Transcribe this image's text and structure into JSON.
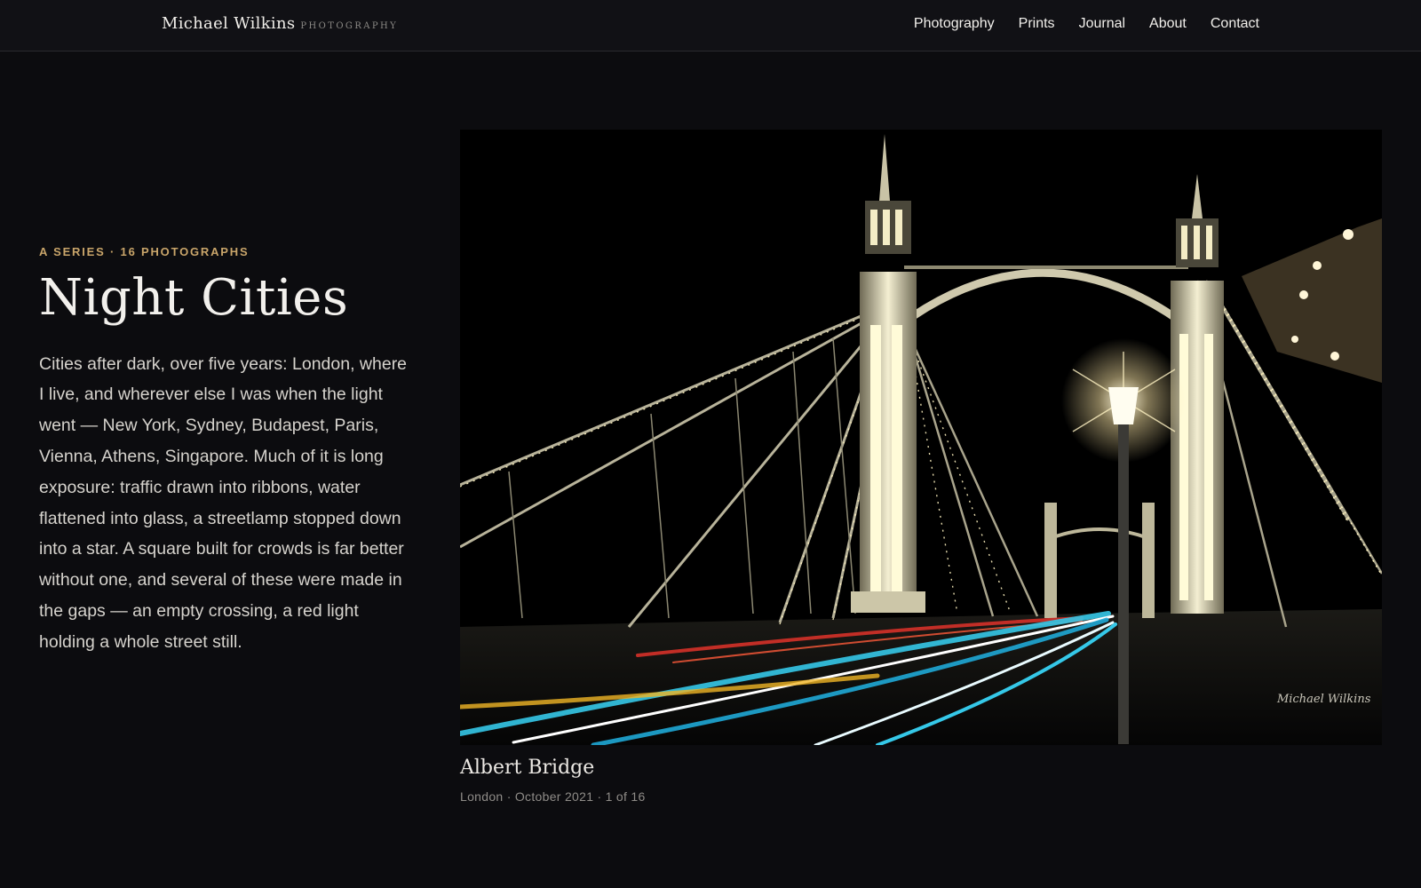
{
  "header": {
    "brand_name": "Michael Wilkins",
    "brand_sub": "Photography",
    "nav": [
      {
        "label": "Photography"
      },
      {
        "label": "Prints"
      },
      {
        "label": "Journal"
      },
      {
        "label": "About"
      },
      {
        "label": "Contact"
      }
    ]
  },
  "series": {
    "eyebrow": "A Series · 16 Photographs",
    "title": "Night Cities",
    "description": "Cities after dark, over five years: London, where I live, and wherever else I was when the light went — New York, Sydney, Budapest, Paris, Vienna, Athens, Singapore. Much of it is long exposure: traffic drawn into ribbons, water flattened into glass, a streetlamp stopped down into a star. A square built for crowds is far better without one, and several of these were made in the gaps — an empty crossing, a red light holding a whole street still."
  },
  "photo": {
    "title": "Albert Bridge",
    "meta": "London · October 2021 · 1 of 16",
    "signature": "Michael Wilkins",
    "colors": {
      "sky": "#000000",
      "bridge": "#d8d2b8",
      "lights": "#fff4c8",
      "trail_red": "#e0322a",
      "trail_cyan": "#35c8e8",
      "lamp": "#fff7dc"
    }
  }
}
